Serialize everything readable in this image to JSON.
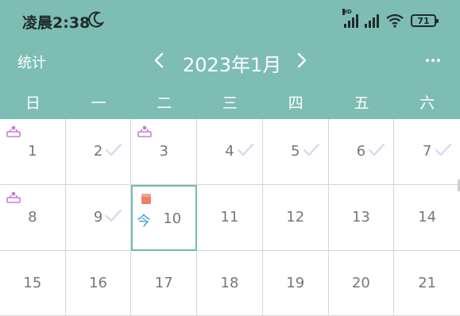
{
  "status_bar": {
    "time": "凌晨2:38",
    "hd": "HD",
    "battery": "71"
  },
  "nav": {
    "stats": "统计",
    "month_title": "2023年1月"
  },
  "weekdays": [
    "日",
    "一",
    "二",
    "三",
    "四",
    "五",
    "六"
  ],
  "today_label": "今",
  "days": [
    {
      "num": "1",
      "badge": "purple-figure-icon",
      "check": false,
      "today": false
    },
    {
      "num": "2",
      "badge": "",
      "check": true,
      "today": false
    },
    {
      "num": "3",
      "badge": "purple-figure-icon",
      "check": false,
      "today": false
    },
    {
      "num": "4",
      "badge": "",
      "check": true,
      "today": false
    },
    {
      "num": "5",
      "badge": "",
      "check": true,
      "today": false
    },
    {
      "num": "6",
      "badge": "",
      "check": true,
      "today": false
    },
    {
      "num": "7",
      "badge": "",
      "check": true,
      "today": false
    },
    {
      "num": "8",
      "badge": "purple-figure-icon",
      "check": false,
      "today": false
    },
    {
      "num": "9",
      "badge": "",
      "check": true,
      "today": false
    },
    {
      "num": "10",
      "badge": "orange-cube-icon",
      "check": false,
      "today": true
    },
    {
      "num": "11",
      "badge": "",
      "check": false,
      "today": false
    },
    {
      "num": "12",
      "badge": "",
      "check": false,
      "today": false
    },
    {
      "num": "13",
      "badge": "",
      "check": false,
      "today": false
    },
    {
      "num": "14",
      "badge": "",
      "check": false,
      "today": false
    },
    {
      "num": "15",
      "badge": "",
      "check": false,
      "today": false
    },
    {
      "num": "16",
      "badge": "",
      "check": false,
      "today": false
    },
    {
      "num": "17",
      "badge": "",
      "check": false,
      "today": false
    },
    {
      "num": "18",
      "badge": "",
      "check": false,
      "today": false
    },
    {
      "num": "19",
      "badge": "",
      "check": false,
      "today": false
    },
    {
      "num": "20",
      "badge": "",
      "check": false,
      "today": false
    },
    {
      "num": "21",
      "badge": "",
      "check": false,
      "today": false
    }
  ],
  "colors": {
    "header_bg": "#7dbdb4",
    "today_border": "#6fbdb1",
    "today_label": "#2b9ad6",
    "checkmark": "#dcd8f3",
    "purple_badge": "#c77fd6",
    "orange_badge": "#f07f6a"
  }
}
